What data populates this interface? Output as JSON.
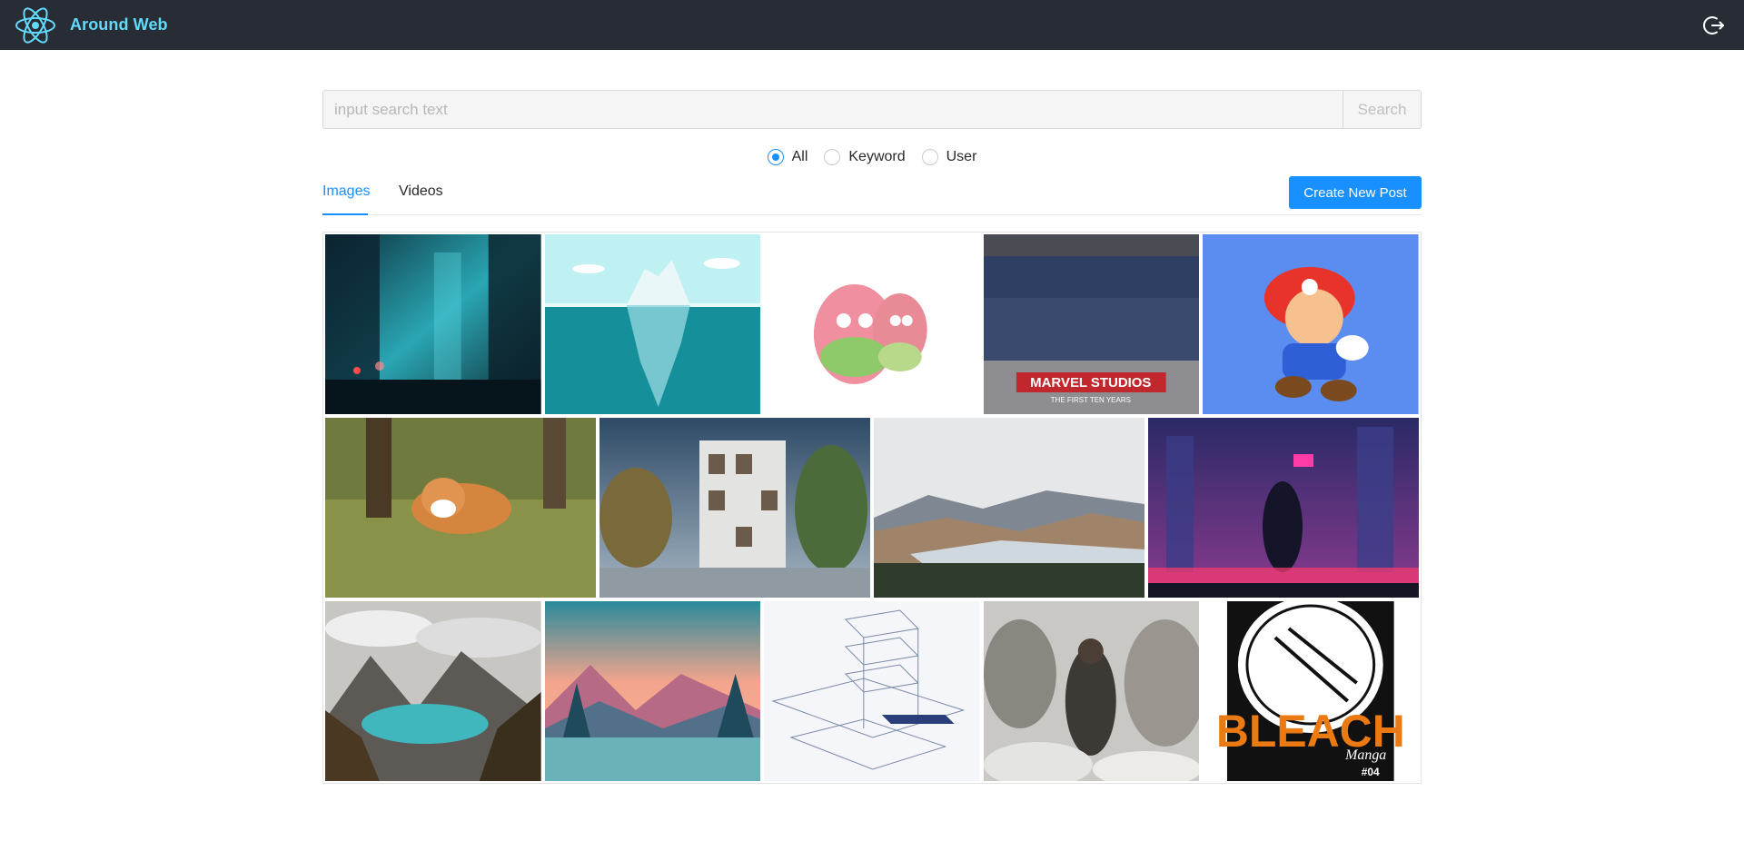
{
  "header": {
    "title": "Around Web",
    "logo_icon": "react-atom-icon",
    "logout_icon": "logout-icon",
    "bg_color": "#282c34",
    "accent_color": "#61dafb"
  },
  "search": {
    "placeholder": "input search text",
    "value": "",
    "button_label": "Search"
  },
  "search_type": {
    "selected": "All",
    "options": [
      "All",
      "Keyword",
      "User"
    ]
  },
  "tabs": {
    "active": "Images",
    "items": [
      "Images",
      "Videos"
    ]
  },
  "create_post_label": "Create New Post",
  "primary_color": "#1890ff",
  "gallery": {
    "rows": [
      [
        "city street at night (teal)",
        "iceberg illustration",
        "pink cartoon characters",
        "Marvel Studios group photo",
        "cartoon plumber on blue"
      ],
      [
        "corgi on grass",
        "modern building render",
        "mountain lake valley",
        "cyberpunk city skyline"
      ],
      [
        "mountain lake with pine trees",
        "sunset mountains illustration",
        "architectural line drawing",
        "warrior in snow",
        "manga cover black and white"
      ]
    ],
    "image_texts": {
      "marvel": "MARVEL STUDIOS",
      "marvel_sub": "THE FIRST TEN YEARS",
      "bleach": "BLEACH",
      "bleach_sub": "Manga",
      "bleach_num": "#04"
    }
  }
}
